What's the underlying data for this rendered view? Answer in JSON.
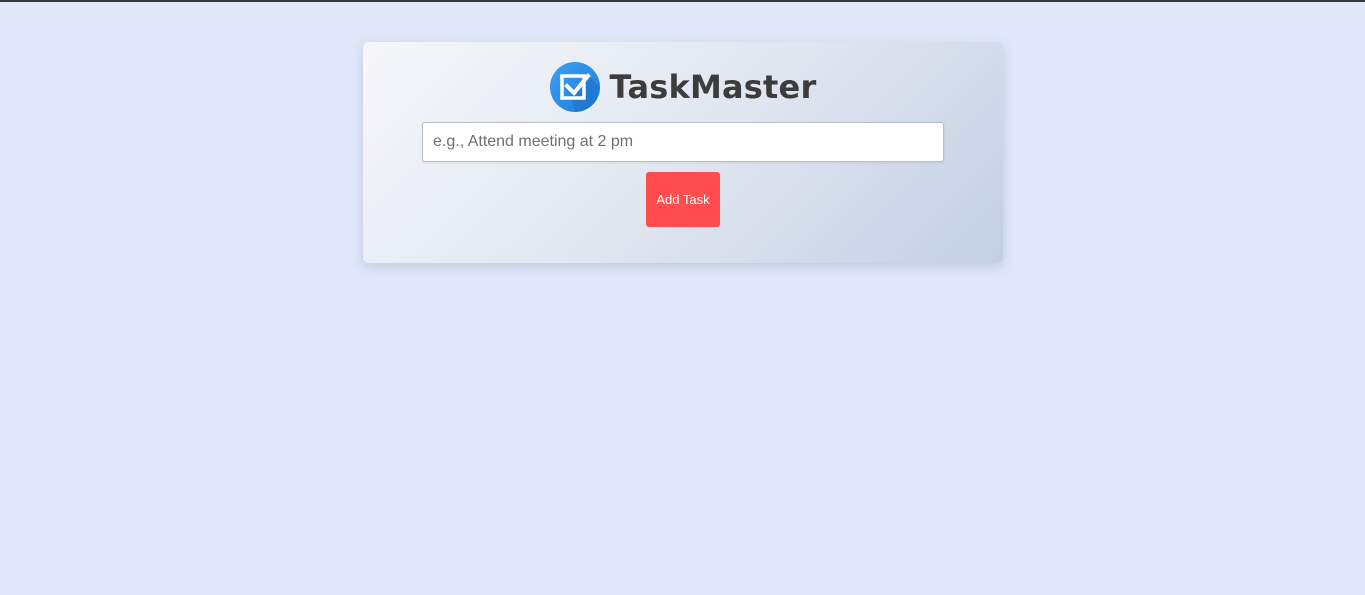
{
  "app": {
    "title": "TaskMaster",
    "logo_icon": "checkbox-check-icon"
  },
  "task_input": {
    "value": "",
    "placeholder": "e.g., Attend meeting at 2 pm"
  },
  "add_button": {
    "label": "Add Task"
  },
  "colors": {
    "page_background": "#e0e8f9",
    "accent_button": "#ff4c4f",
    "logo_circle": "#2b8de8",
    "title_text": "#3c3c3c"
  }
}
